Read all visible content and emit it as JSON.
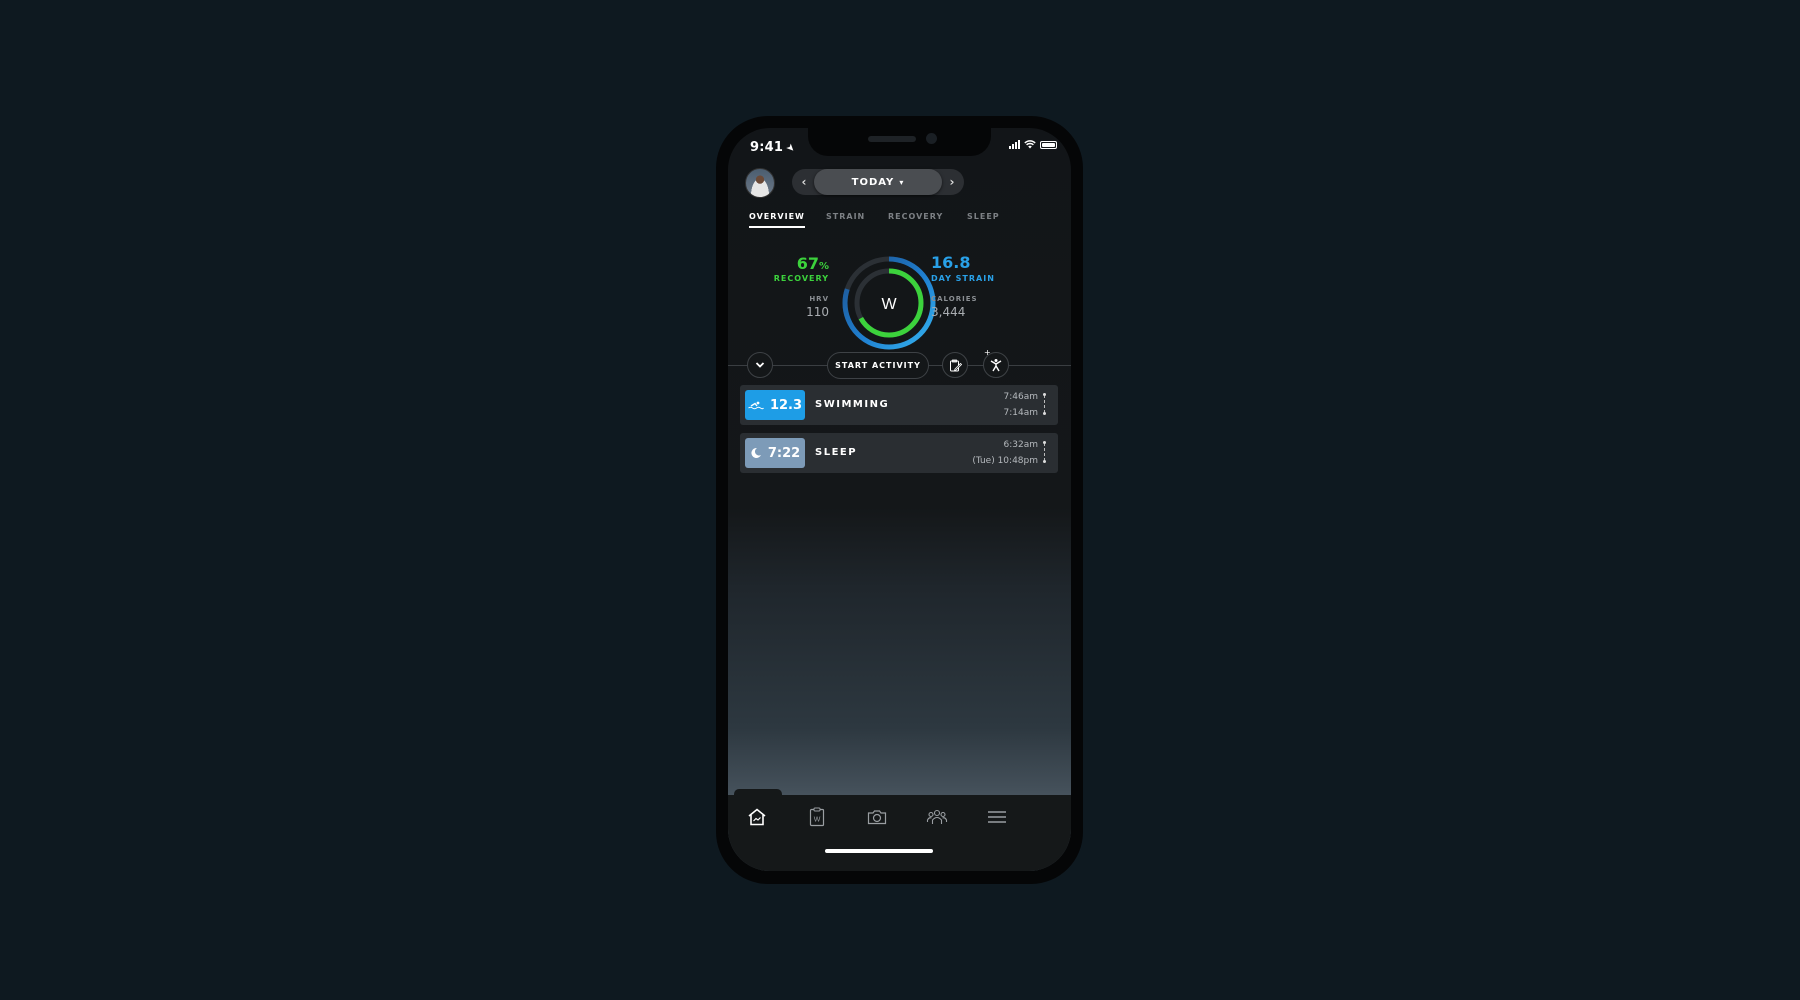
{
  "status_bar": {
    "time": "9:41",
    "signal_bars": 4,
    "battery_level": 1.0
  },
  "header": {
    "date_label": "TODAY",
    "prev_icon": "chevron-left-icon",
    "next_icon": "chevron-right-icon"
  },
  "tabs": [
    {
      "label": "OVERVIEW",
      "active": true
    },
    {
      "label": "STRAIN",
      "active": false
    },
    {
      "label": "RECOVERY",
      "active": false
    },
    {
      "label": "SLEEP",
      "active": false
    }
  ],
  "overview": {
    "recovery_value": "67",
    "recovery_unit": "%",
    "recovery_label": "RECOVERY",
    "recovery_fraction": 0.67,
    "hrv_label": "HRV",
    "hrv_value": "110",
    "strain_value": "16.8",
    "strain_label": "DAY STRAIN",
    "strain_fraction": 0.8,
    "calories_label": "CALORIES",
    "calories_value": "3,444",
    "logo_text": "W",
    "colors": {
      "recovery": "#3cd23c",
      "strain": "#29a1e8"
    }
  },
  "actions": {
    "start_activity_label": "START ACTIVITY",
    "expand_icon": "chevron-down-icon",
    "journal_icon": "clipboard-edit-icon",
    "add_activity_icon": "person-plus-icon",
    "plus": "+"
  },
  "activities": [
    {
      "icon": "swimming-icon",
      "score": "12.3",
      "title": "SWIMMING",
      "end_time": "7:46am",
      "start_time": "7:14am",
      "color": "#1e9de6"
    },
    {
      "icon": "moon-icon",
      "score": "7:22",
      "title": "SLEEP",
      "end_time": "6:32am",
      "start_time": "(Tue) 10:48pm",
      "color": "#7d9bb8"
    }
  ],
  "bottom_nav": [
    {
      "name": "home",
      "icon": "home-chart-icon",
      "active": true
    },
    {
      "name": "journal",
      "icon": "clipboard-w-icon",
      "active": false
    },
    {
      "name": "camera",
      "icon": "camera-icon",
      "active": false
    },
    {
      "name": "community",
      "icon": "people-icon",
      "active": false
    },
    {
      "name": "menu",
      "icon": "hamburger-menu-icon",
      "active": false
    }
  ]
}
